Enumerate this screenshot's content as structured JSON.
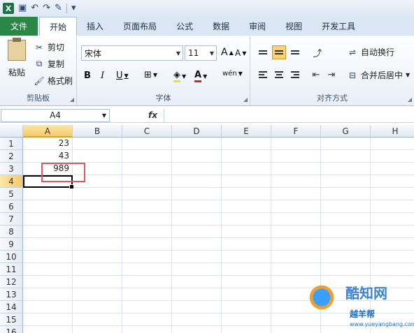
{
  "qat": {
    "logo": "X",
    "undo": "↶",
    "redo": "↷",
    "more": "▾"
  },
  "tabs": [
    "文件",
    "开始",
    "插入",
    "页面布局",
    "公式",
    "数据",
    "审阅",
    "视图",
    "开发工具"
  ],
  "clipboard": {
    "paste": "粘贴",
    "cut": "剪切",
    "copy": "复制",
    "format_painter": "格式刷",
    "group": "剪贴板"
  },
  "font": {
    "name": "宋体",
    "size": "11",
    "grow": "A",
    "shrink": "A",
    "bold": "B",
    "italic": "I",
    "underline": "U",
    "wen": "wén",
    "group": "字体",
    "text_color": "A"
  },
  "alignment": {
    "wrap": "自动换行",
    "merge": "合并后居中",
    "group": "对齐方式"
  },
  "formula_bar": {
    "namebox": "A4",
    "fx": "fx",
    "value": ""
  },
  "columns": [
    "A",
    "B",
    "C",
    "D",
    "E",
    "F",
    "G",
    "H"
  ],
  "rows": [
    "1",
    "2",
    "3",
    "4",
    "5",
    "6",
    "7",
    "8",
    "9",
    "10",
    "11",
    "12",
    "13",
    "14",
    "15",
    "16"
  ],
  "cells": {
    "A1": "23",
    "A2": "43",
    "A3": "989"
  },
  "active_cell": "A4",
  "watermark": {
    "brand": "酷知网",
    "sub": "越羊帮",
    "url": "www.yueyangbang.com"
  },
  "colors": {
    "file_tab": "#2a8745",
    "selection_header": "#f5c96a",
    "highlight_box": "#e05a5a"
  }
}
